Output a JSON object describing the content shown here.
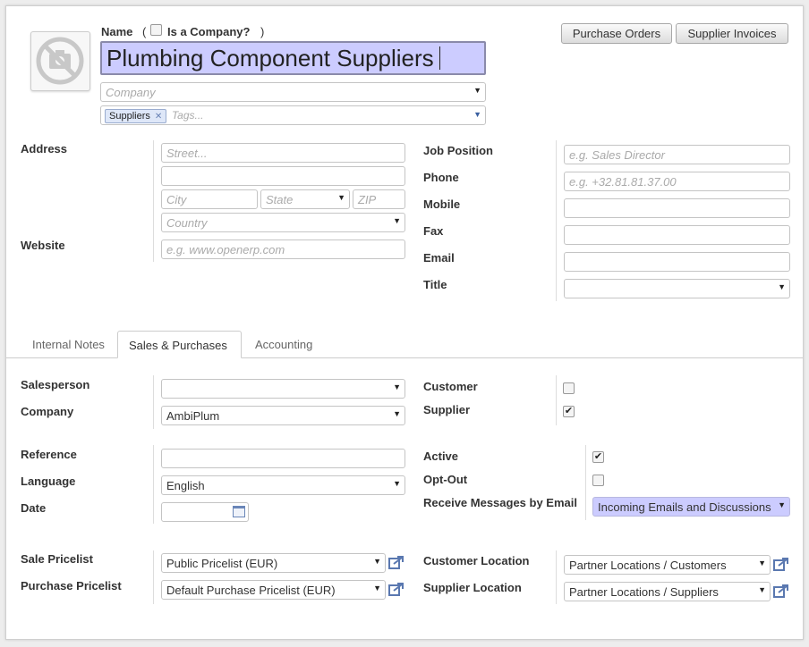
{
  "header": {
    "name_label": "Name",
    "paren_open": "(",
    "paren_close": ")",
    "is_company_label": "Is a Company?",
    "name_value": "Plumbing Component Suppliers",
    "company_placeholder": "Company",
    "tag_chip": "Suppliers",
    "tags_placeholder": "Tags...",
    "purchase_orders_button": "Purchase Orders",
    "supplier_invoices_button": "Supplier Invoices"
  },
  "address": {
    "address_label": "Address",
    "street_placeholder": "Street...",
    "city_placeholder": "City",
    "state_placeholder": "State",
    "zip_placeholder": "ZIP",
    "country_placeholder": "Country",
    "website_label": "Website",
    "website_placeholder": "e.g. www.openerp.com"
  },
  "contact": {
    "job_position_label": "Job Position",
    "job_position_placeholder": "e.g. Sales Director",
    "phone_label": "Phone",
    "phone_placeholder": "e.g. +32.81.81.37.00",
    "mobile_label": "Mobile",
    "fax_label": "Fax",
    "email_label": "Email",
    "title_label": "Title"
  },
  "tabs": [
    {
      "label": "Internal Notes"
    },
    {
      "label": "Sales & Purchases"
    },
    {
      "label": "Accounting"
    }
  ],
  "sales": {
    "salesperson_label": "Salesperson",
    "company_label": "Company",
    "company_value": "AmbiPlum",
    "customer_label": "Customer",
    "customer_checked": false,
    "supplier_label": "Supplier",
    "supplier_checked": true,
    "reference_label": "Reference",
    "language_label": "Language",
    "language_value": "English",
    "date_label": "Date",
    "active_label": "Active",
    "active_checked": true,
    "opt_out_label": "Opt-Out",
    "opt_out_checked": false,
    "receive_messages_label": "Receive Messages by Email",
    "receive_messages_value": "Incoming Emails and Discussions",
    "sale_pricelist_label": "Sale Pricelist",
    "sale_pricelist_value": "Public Pricelist (EUR)",
    "purchase_pricelist_label": "Purchase Pricelist",
    "purchase_pricelist_value": "Default Purchase Pricelist (EUR)",
    "customer_location_label": "Customer Location",
    "customer_location_value": "Partner Locations / Customers",
    "supplier_location_label": "Supplier Location",
    "supplier_location_value": "Partner Locations / Suppliers"
  },
  "icons": {
    "dropdown": "caret-down-icon",
    "external_link": "external-link-icon",
    "calendar": "calendar-icon",
    "no_photo": "no-photo-icon",
    "tag_remove": "close-icon"
  },
  "colors": {
    "name_field_bg": "#ccccff",
    "messages_select_bg": "#ccccff",
    "tag_chip_bg": "#dee7f8"
  }
}
